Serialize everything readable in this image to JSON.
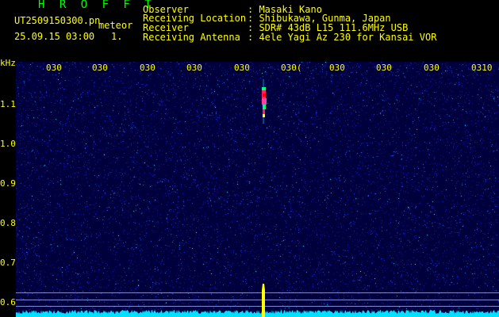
{
  "header": {
    "title": "H R O F F T",
    "filename": "UT2509150300.pn",
    "tag": "meteor",
    "datetime": "25.09.15 03:00",
    "index": "1.",
    "info": [
      {
        "label": "Observer",
        "value": ": Masaki Kano"
      },
      {
        "label": "Receiving Location",
        "value": ": Shibukawa, Gunma, Japan"
      },
      {
        "label": "Receiver",
        "value": ": SDR# 43dB L15 111.6MHz USB"
      },
      {
        "label": "Receiving Antenna",
        "value": ": 4ele Yagi Az 230 for Kansai VOR"
      }
    ]
  },
  "y_axis": {
    "unit": "kHz",
    "ticks": [
      "1.1",
      "1.0",
      "0.9",
      "0.8",
      "0.7",
      "0.6"
    ]
  },
  "x_axis": {
    "ticks": [
      "030",
      "030",
      "030",
      "030",
      "030",
      "030(",
      "030",
      "030",
      "030",
      "0310"
    ]
  },
  "colors": {
    "background": "#000000",
    "plot_bg": "#00003c",
    "label": "#ffff00",
    "title": "#00ff00",
    "baseline": "#00e0ff",
    "signal": "#ffff00",
    "echo": "#ff2060"
  }
}
